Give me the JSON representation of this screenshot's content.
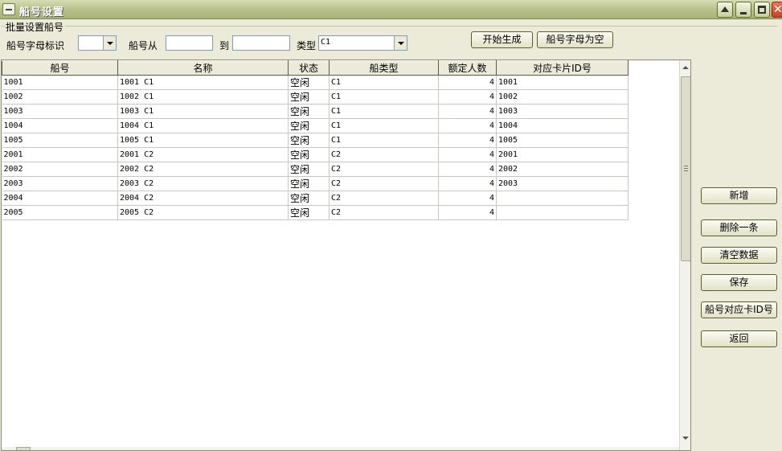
{
  "window": {
    "title": "船号设置"
  },
  "batch": {
    "group_label": "批量设置船号",
    "letter_label": "船号字母标识",
    "letter_value": "",
    "from_label": "船号从",
    "from_value": "",
    "to_label": "到",
    "to_value": "",
    "type_label": "类型",
    "type_value": "C1",
    "generate_label": "开始生成",
    "clear_letter_label": "船号字母为空"
  },
  "table": {
    "columns": [
      "船号",
      "名称",
      "状态",
      "船类型",
      "额定人数",
      "对应卡片ID号"
    ],
    "rows": [
      [
        "1001",
        "1001 C1",
        "空闲",
        "C1",
        "4",
        "1001"
      ],
      [
        "1002",
        "1002 C1",
        "空闲",
        "C1",
        "4",
        "1002"
      ],
      [
        "1003",
        "1003 C1",
        "空闲",
        "C1",
        "4",
        "1003"
      ],
      [
        "1004",
        "1004 C1",
        "空闲",
        "C1",
        "4",
        "1004"
      ],
      [
        "1005",
        "1005 C1",
        "空闲",
        "C1",
        "4",
        "1005"
      ],
      [
        "2001",
        "2001 C2",
        "空闲",
        "C2",
        "4",
        "2001"
      ],
      [
        "2002",
        "2002 C2",
        "空闲",
        "C2",
        "4",
        "2002"
      ],
      [
        "2003",
        "2003 C2",
        "空闲",
        "C2",
        "4",
        "2003"
      ],
      [
        "2004",
        "2004 C2",
        "空闲",
        "C2",
        "4",
        ""
      ],
      [
        "2005",
        "2005 C2",
        "空闲",
        "C2",
        "4",
        ""
      ]
    ]
  },
  "actions": {
    "add": "新增",
    "delete_one": "删除一条",
    "clear_data": "清空数据",
    "save": "保存",
    "map_card_id": "船号对应卡ID号",
    "back": "返回"
  }
}
